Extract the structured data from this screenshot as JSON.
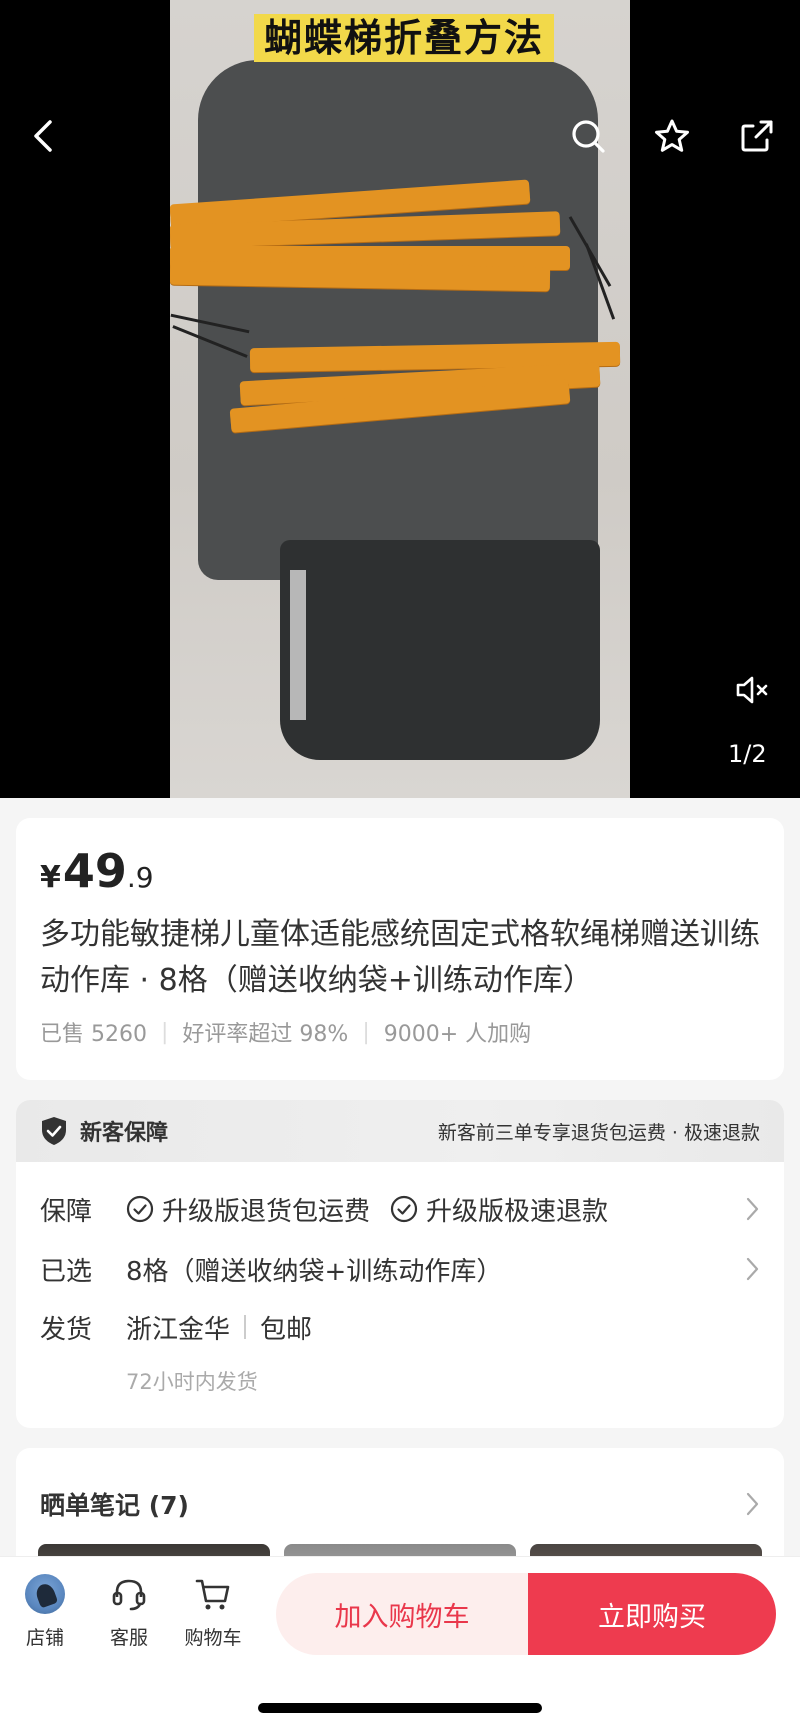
{
  "media": {
    "video_title": "蝴蝶梯折叠方法",
    "page_counter": "1/2",
    "icons": {
      "back": "chevron-left-icon",
      "search": "search-icon",
      "favorite": "star-icon",
      "share": "share-icon",
      "mute": "speaker-muted-icon"
    }
  },
  "product": {
    "price_symbol": "¥",
    "price_integer": "49",
    "price_decimal": ".9",
    "title": "多功能敏捷梯儿童体适能感统固定式格软绳梯赠送训练动作库 · 8格（赠送收纳袋+训练动作库）",
    "stats": {
      "sold": "已售 5260",
      "rating": "好评率超过 98%",
      "cart_adds": "9000+ 人加购"
    }
  },
  "guarantee": {
    "header_name": "新客保障",
    "header_desc": "新客前三单专享退货包运费 · 极速退款",
    "rows": {
      "protection_label": "保障",
      "protection_items": [
        "升级版退货包运费",
        "升级版极速退款"
      ],
      "selected_label": "已选",
      "selected_value": "8格（赠送收纳袋+训练动作库）",
      "shipping_label": "发货",
      "shipping_origin": "浙江金华",
      "shipping_fee": "包邮",
      "shipping_time": "72小时内发货"
    }
  },
  "notes": {
    "title": "晒单笔记 (7)"
  },
  "bottom_bar": {
    "store_label": "店铺",
    "service_label": "客服",
    "cart_label": "购物车",
    "add_to_cart": "加入购物车",
    "buy_now": "立即购买",
    "accent_color": "#ee3b4f"
  }
}
